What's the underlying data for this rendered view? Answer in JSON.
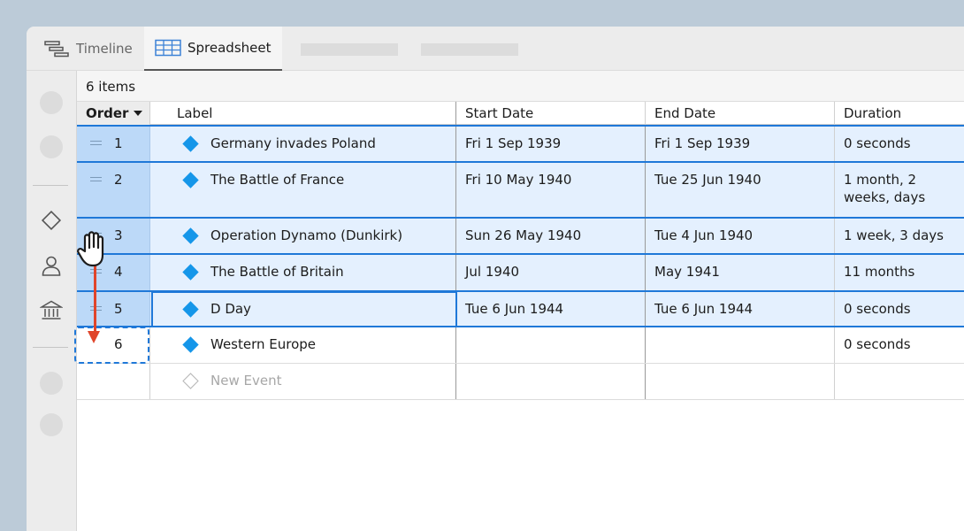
{
  "tabs": {
    "timeline_label": "Timeline",
    "spreadsheet_label": "Spreadsheet"
  },
  "toolbar": {
    "item_count": "6 items"
  },
  "columns": {
    "order": "Order",
    "label": "Label",
    "start": "Start Date",
    "end": "End Date",
    "duration": "Duration"
  },
  "rows": [
    {
      "order": "1",
      "label": "Germany invades Poland",
      "start": "Fri 1 Sep 1939",
      "end": "Fri 1 Sep 1939",
      "duration": "0 seconds"
    },
    {
      "order": "2",
      "label": "The Battle of France",
      "start": "Fri 10 May 1940",
      "end": "Tue 25 Jun 1940",
      "duration": "1 month, 2 weeks, days"
    },
    {
      "order": "3",
      "label": "Operation Dynamo (Dunkirk)",
      "start": "Sun 26 May 1940",
      "end": "Tue 4 Jun 1940",
      "duration": "1 week, 3 days"
    },
    {
      "order": "4",
      "label": "The Battle of Britain",
      "start": "Jul 1940",
      "end": "May 1941",
      "duration": "11 months"
    },
    {
      "order": "5",
      "label": "D Day",
      "start": "Tue 6 Jun 1944",
      "end": "Tue 6 Jun 1944",
      "duration": "0 seconds"
    },
    {
      "order": "6",
      "label": "Western Europe",
      "start": "",
      "end": "",
      "duration": "0 seconds"
    }
  ],
  "new_row": {
    "label": "New Event"
  },
  "colors": {
    "accent": "#1f78d8",
    "selection": "#e4f0fe",
    "event_diamond": "#1596e9",
    "drag_arrow": "#e0452a"
  }
}
